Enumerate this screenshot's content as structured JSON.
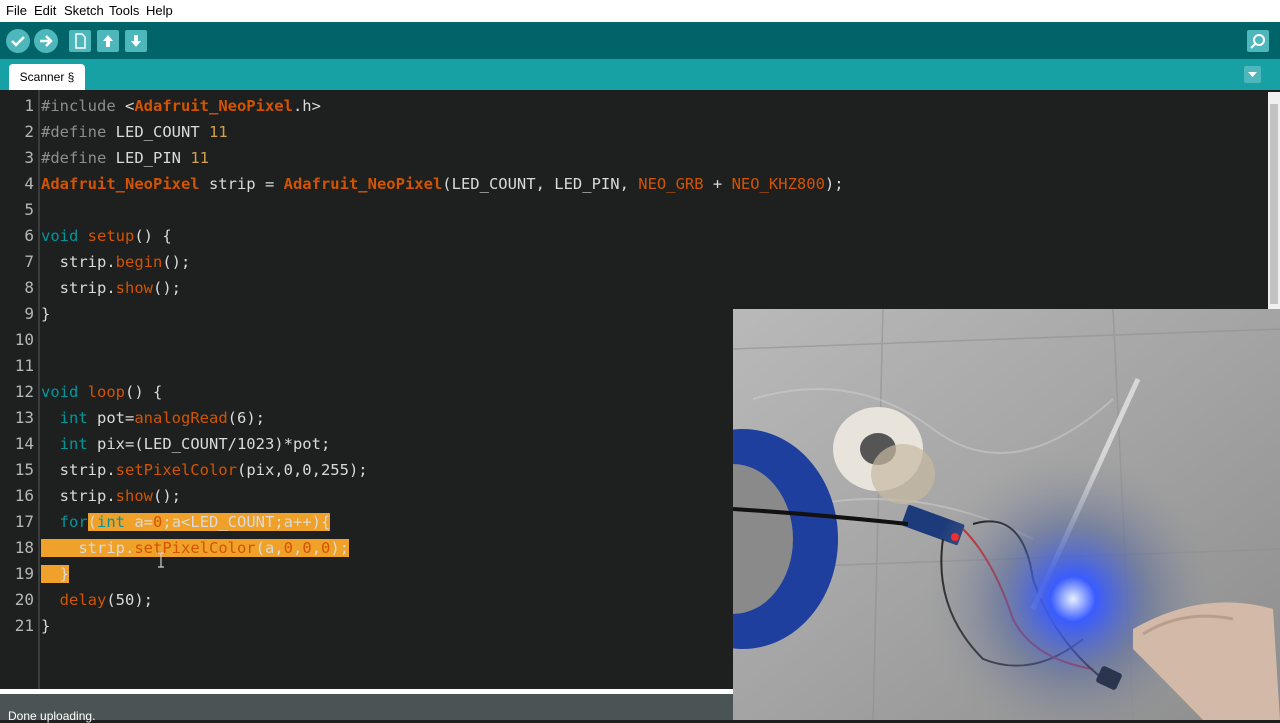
{
  "menu": [
    "File",
    "Edit",
    "Sketch",
    "Tools",
    "Help"
  ],
  "toolbar": {
    "verify": "verify-icon",
    "upload": "upload-arrow-icon",
    "new": "new-file-icon",
    "open": "open-icon",
    "save": "save-icon",
    "serial_monitor": "magnifier-icon"
  },
  "tab": {
    "label": "Scanner §"
  },
  "line_numbers": [
    "1",
    "2",
    "3",
    "4",
    "5",
    "6",
    "7",
    "8",
    "9",
    "10",
    "11",
    "12",
    "13",
    "14",
    "15",
    "16",
    "17",
    "18",
    "19",
    "20",
    "21"
  ],
  "status": {
    "text": "Done uploading."
  },
  "colors": {
    "toolbar": "#006468",
    "tabbar": "#17a1a5",
    "editor_bg": "#1e1f1f",
    "selection": "#f0a12a",
    "status": "#4b5454"
  }
}
